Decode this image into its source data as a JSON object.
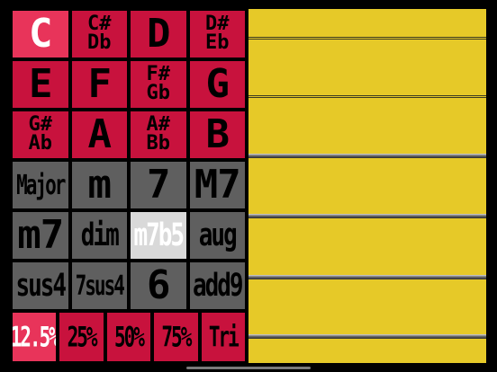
{
  "notes": [
    {
      "label": "C",
      "selected": true
    },
    {
      "label": "C#\nDb",
      "selected": false
    },
    {
      "label": "D",
      "selected": false
    },
    {
      "label": "D#\nEb",
      "selected": false
    },
    {
      "label": "E",
      "selected": false
    },
    {
      "label": "F",
      "selected": false
    },
    {
      "label": "F#\nGb",
      "selected": false
    },
    {
      "label": "G",
      "selected": false
    },
    {
      "label": "G#\nAb",
      "selected": false
    },
    {
      "label": "A",
      "selected": false
    },
    {
      "label": "A#\nBb",
      "selected": false
    },
    {
      "label": "B",
      "selected": false
    }
  ],
  "qualities": [
    {
      "label": "Major",
      "selected": false
    },
    {
      "label": "m",
      "selected": false
    },
    {
      "label": "7",
      "selected": false
    },
    {
      "label": "M7",
      "selected": false
    },
    {
      "label": "m7",
      "selected": false
    },
    {
      "label": "dim",
      "selected": false
    },
    {
      "label": "m7b5",
      "selected": true
    },
    {
      "label": "aug",
      "selected": false
    },
    {
      "label": "sus4",
      "selected": false
    },
    {
      "label": "7sus4",
      "selected": false
    },
    {
      "label": "6",
      "selected": false
    },
    {
      "label": "add9",
      "selected": false
    }
  ],
  "duty": [
    {
      "label": "12.5%",
      "selected": true
    },
    {
      "label": "25%",
      "selected": false
    },
    {
      "label": "50%",
      "selected": false
    },
    {
      "label": "75%",
      "selected": false
    },
    {
      "label": "Tri",
      "selected": false
    }
  ],
  "colors": {
    "note_key": "#c8123d",
    "selected_key": "#e8345a",
    "quality_key": "#5f5f5f",
    "selected_quality": "#d9d9d9",
    "strum_area": "#e6c928"
  }
}
